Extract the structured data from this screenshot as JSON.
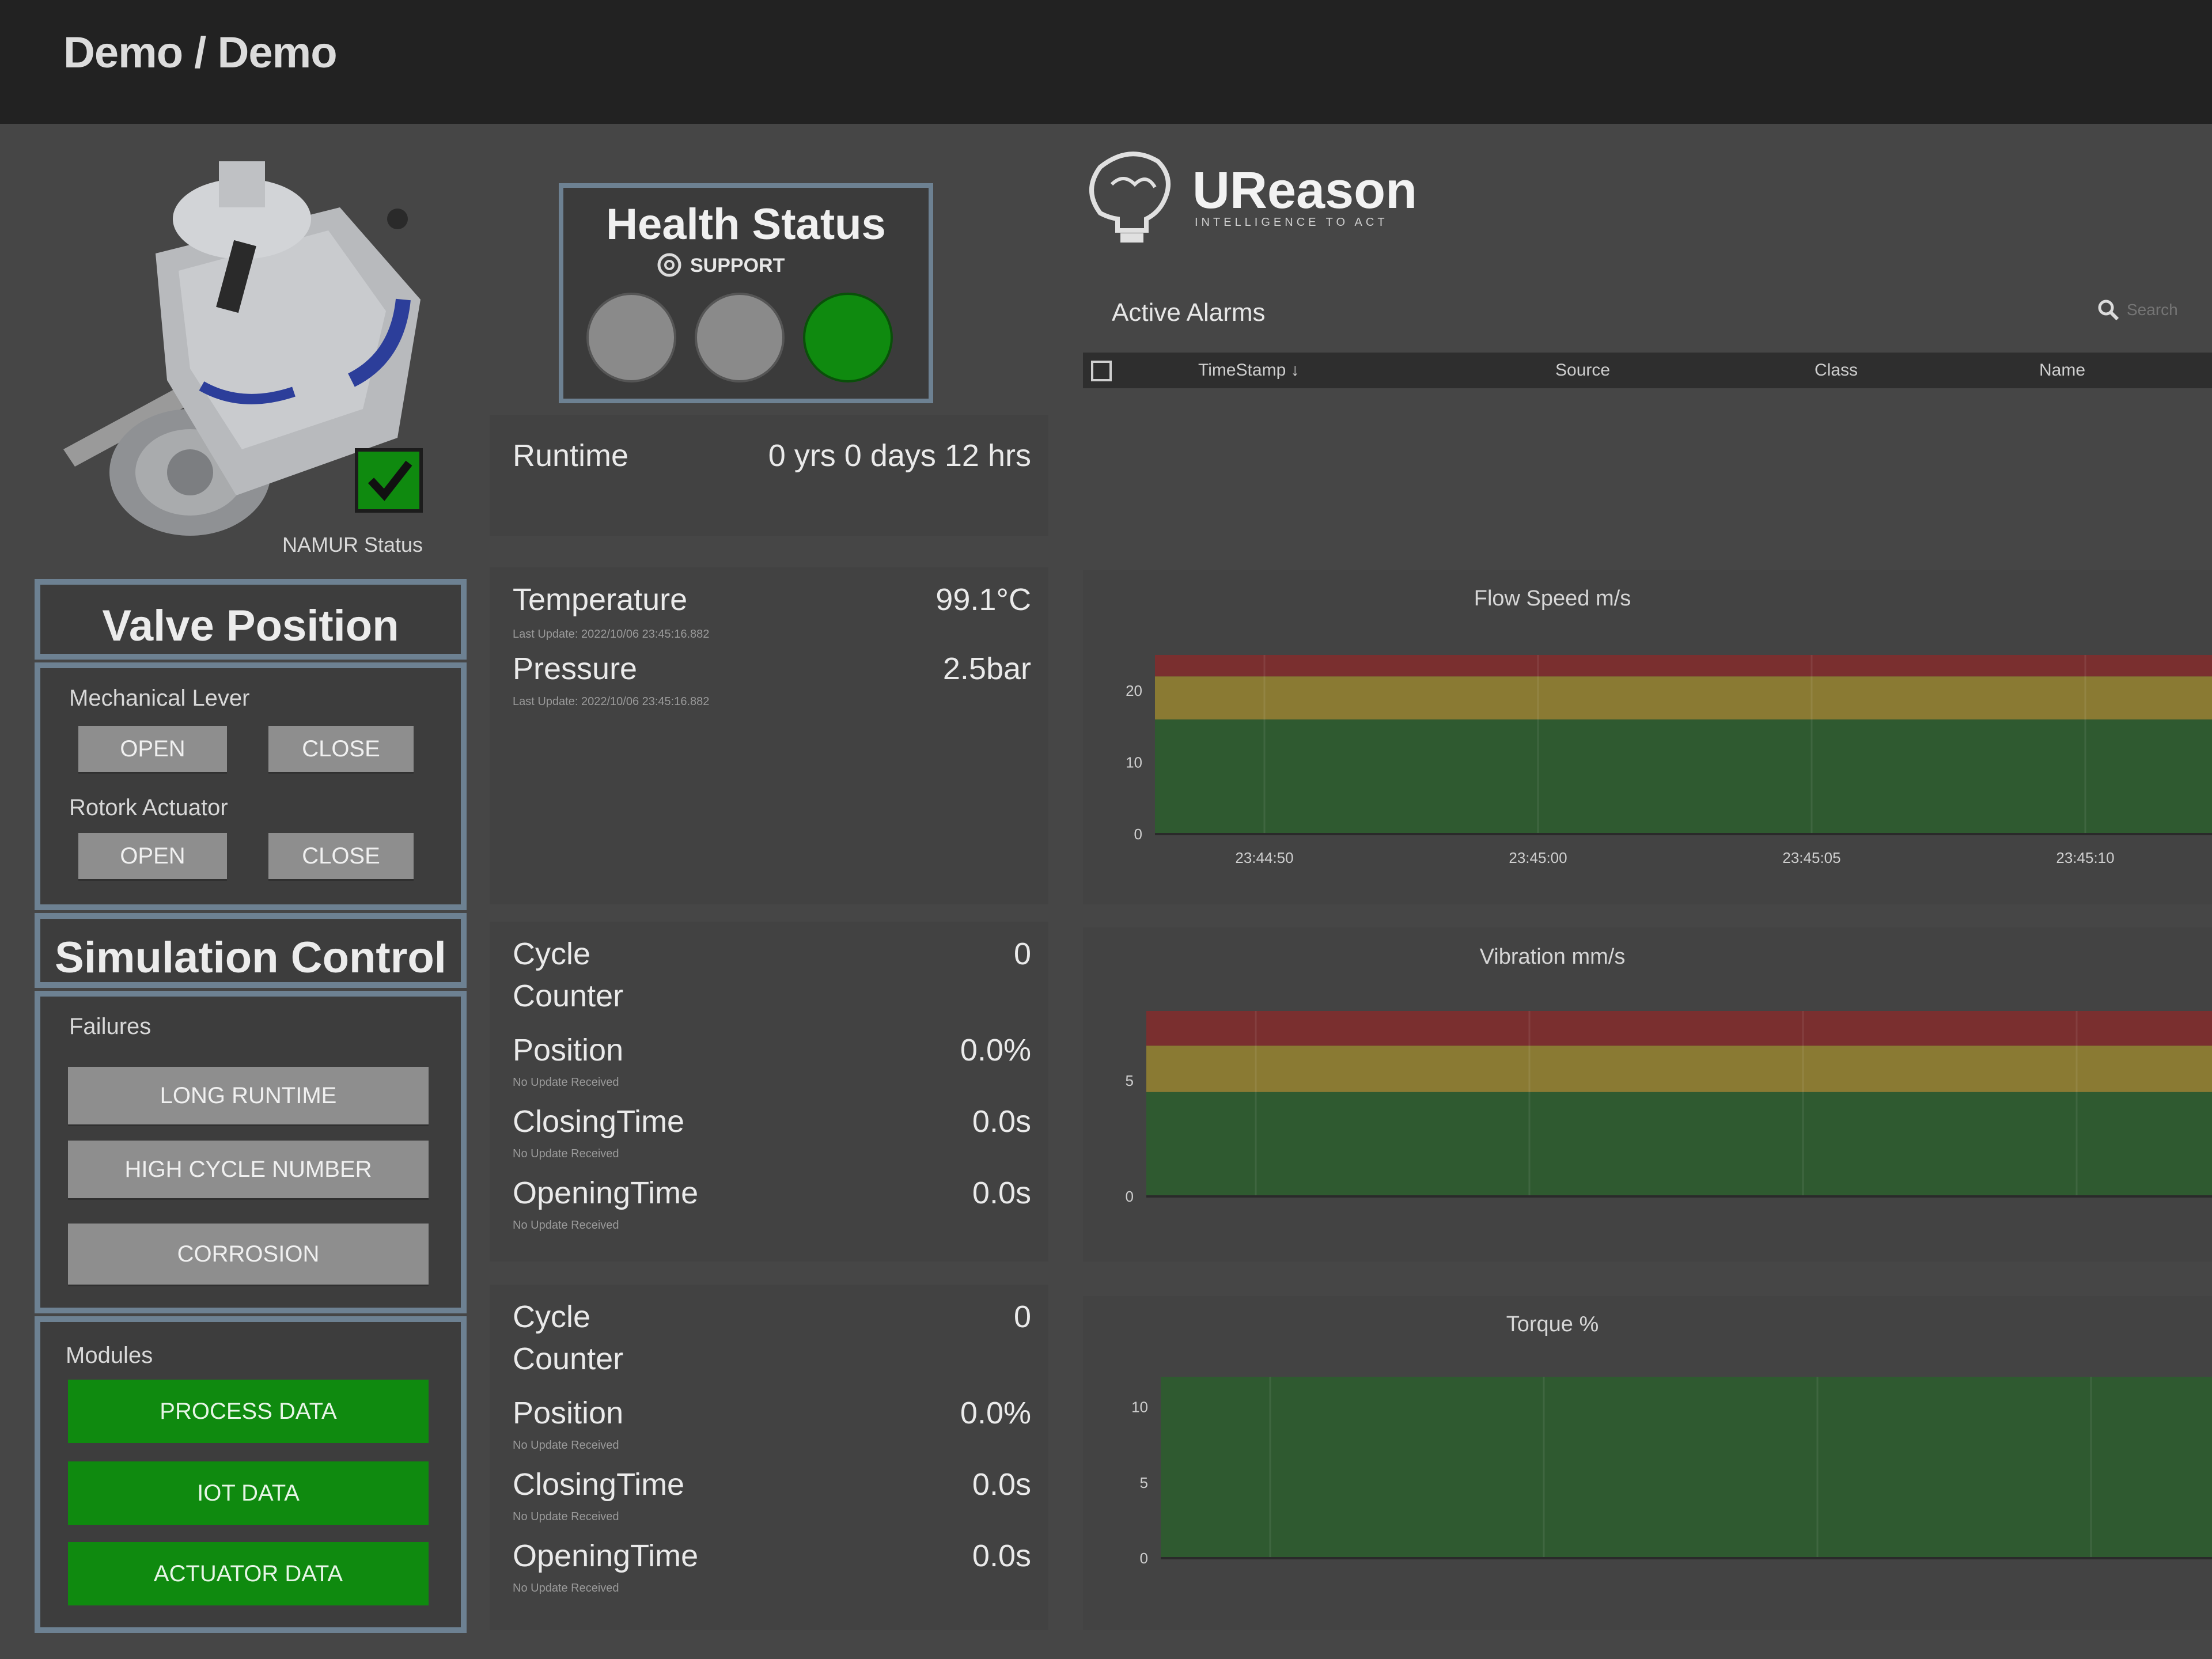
{
  "header": {
    "title": "Demo / Demo"
  },
  "device": {
    "namur_label": "NAMUR Status",
    "namur_ok": true
  },
  "valve_position": {
    "title": "Valve Position",
    "mechanical_lever": {
      "label": "Mechanical Lever",
      "open": "OPEN",
      "close": "CLOSE"
    },
    "rotork_actuator": {
      "label": "Rotork Actuator",
      "open": "OPEN",
      "close": "CLOSE"
    }
  },
  "simulation_control": {
    "title": "Simulation Control",
    "failures_label": "Failures",
    "failures": [
      "LONG RUNTIME",
      "HIGH CYCLE NUMBER",
      "CORROSION"
    ],
    "modules_label": "Modules",
    "modules": [
      "PROCESS DATA",
      "IOT DATA",
      "ACTUATOR DATA"
    ]
  },
  "health": {
    "title": "Health Status",
    "support_label": "SUPPORT",
    "lights": [
      "#8a8a8a",
      "#8a8a8a",
      "#0f8a0f"
    ]
  },
  "runtime": {
    "label": "Runtime",
    "value": "0 yrs 0 days 12 hrs"
  },
  "process": {
    "items": [
      {
        "label": "Temperature",
        "value": "99.1°C",
        "update": "Last Update: 2022/10/06 23:45:16.882"
      },
      {
        "label": "Pressure",
        "value": "2.5bar",
        "update": "Last Update: 2022/10/06 23:45:16.882"
      }
    ]
  },
  "actuator_a": {
    "cycle_label_1": "Cycle",
    "cycle_label_2": "Counter",
    "cycle_value": "0",
    "rows": [
      {
        "label": "Position",
        "value": "0.0%",
        "update": "No Update Received"
      },
      {
        "label": "ClosingTime",
        "value": "0.0s",
        "update": "No Update Received"
      },
      {
        "label": "OpeningTime",
        "value": "0.0s",
        "update": "No Update Received"
      }
    ]
  },
  "actuator_b": {
    "cycle_label_1": "Cycle",
    "cycle_label_2": "Counter",
    "cycle_value": "0",
    "rows": [
      {
        "label": "Position",
        "value": "0.0%",
        "update": "No Update Received"
      },
      {
        "label": "ClosingTime",
        "value": "0.0s",
        "update": "No Update Received"
      },
      {
        "label": "OpeningTime",
        "value": "0.0s",
        "update": "No Update Received"
      }
    ]
  },
  "brand": {
    "name": "UReason",
    "tagline": "INTELLIGENCE TO ACT"
  },
  "alarms": {
    "title": "Active Alarms",
    "search_placeholder": "Search",
    "columns": [
      "TimeStamp",
      "Source",
      "Class",
      "Name"
    ]
  },
  "colors": {
    "band_red": "#7a2f2f",
    "band_yellow": "#8a7a33",
    "band_green": "#2f5a30",
    "accent_green": "#0f8a0f"
  },
  "chart_data": [
    {
      "type": "area",
      "title": "Flow Speed m/s",
      "y_ticks": [
        "0",
        "10",
        "20"
      ],
      "ylim": [
        0,
        25
      ],
      "x_ticks": [
        "23:44:50",
        "23:45:00",
        "23:45:05",
        "23:45:10"
      ],
      "bands": [
        {
          "name": "red",
          "from": 22,
          "to": 25
        },
        {
          "name": "yellow",
          "from": 16,
          "to": 22
        },
        {
          "name": "green",
          "from": 0,
          "to": 16
        }
      ],
      "series": []
    },
    {
      "type": "area",
      "title": "Vibration mm/s",
      "y_ticks": [
        "0",
        "5"
      ],
      "ylim": [
        0,
        8
      ],
      "x_ticks": [],
      "bands": [
        {
          "name": "red",
          "from": 6.5,
          "to": 8
        },
        {
          "name": "yellow",
          "from": 4.5,
          "to": 6.5
        },
        {
          "name": "green",
          "from": 0,
          "to": 4.5
        }
      ],
      "series": []
    },
    {
      "type": "area",
      "title": "Torque %",
      "y_ticks": [
        "0",
        "5",
        "10"
      ],
      "ylim": [
        0,
        12
      ],
      "x_ticks": [],
      "bands": [
        {
          "name": "green",
          "from": 0,
          "to": 12
        }
      ],
      "series": []
    }
  ]
}
